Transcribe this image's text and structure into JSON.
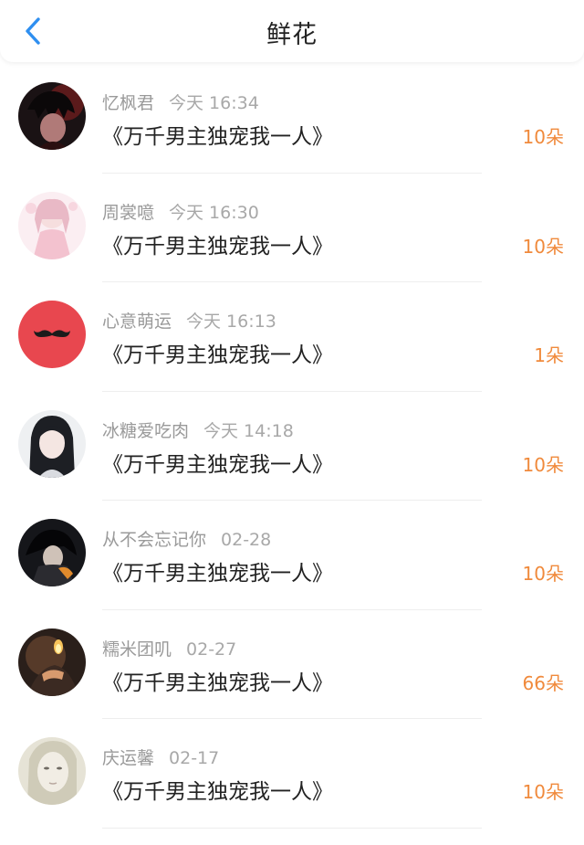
{
  "header": {
    "title": "鲜花",
    "back_icon": "chevron-left-icon",
    "accent_color": "#2f8ff0"
  },
  "colors": {
    "count": "#f08a3c",
    "username": "#9a9a9a"
  },
  "items": [
    {
      "user": "忆枫君",
      "time": "今天 16:34",
      "book": "《万千男主独宠我一人》",
      "count": "10朵",
      "avatar": "dark-haired-anime-avatar"
    },
    {
      "user": "周裳噫",
      "time": "今天 16:30",
      "book": "《万千男主独宠我一人》",
      "count": "10朵",
      "avatar": "pink-anime-girl-avatar"
    },
    {
      "user": "心意萌运",
      "time": "今天 16:13",
      "book": "《万千男主独宠我一人》",
      "count": "1朵",
      "avatar": "mustache-avatar"
    },
    {
      "user": "冰糖爱吃肉",
      "time": "今天 14:18",
      "book": "《万千男主独宠我一人》",
      "count": "10朵",
      "avatar": "anime-girl-avatar"
    },
    {
      "user": "从不会忘记你",
      "time": "02-28",
      "book": "《万千男主独宠我一人》",
      "count": "10朵",
      "avatar": "dark-anime-boy-avatar"
    },
    {
      "user": "糯米团叽",
      "time": "02-27",
      "book": "《万千男主独宠我一人》",
      "count": "66朵",
      "avatar": "candlelight-avatar"
    },
    {
      "user": "庆运馨",
      "time": "02-17",
      "book": "《万千男主独宠我一人》",
      "count": "10朵",
      "avatar": "pale-face-avatar"
    }
  ]
}
